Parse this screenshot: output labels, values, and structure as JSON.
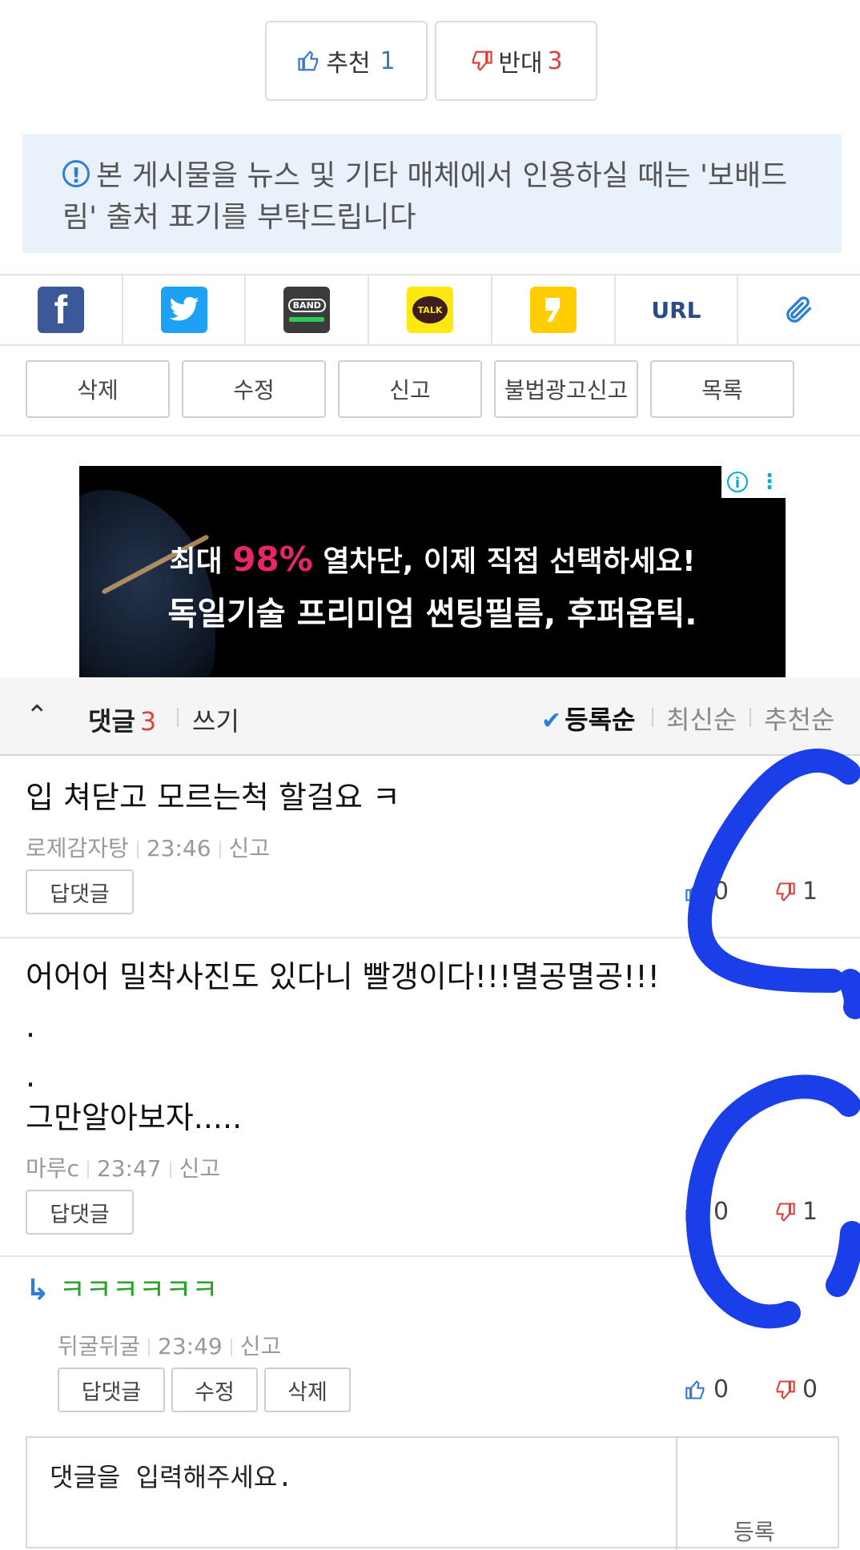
{
  "vote": {
    "up_label": "추천",
    "up_count": "1",
    "down_label": "반대",
    "down_count": "3"
  },
  "notice": {
    "text": "본 게시물을 뉴스 및 기타 매체에서 인용하실 때는 '보배드림' 출처 표기를 부탁드립니다"
  },
  "share": {
    "url_label": "URL",
    "band_label": "BAND",
    "kakao_label": "TALK"
  },
  "actions": [
    "삭제",
    "수정",
    "신고",
    "불법광고신고",
    "목록"
  ],
  "ad": {
    "line1_prefix": "최대",
    "line1_pct": "98%",
    "line1_suffix": "열차단, 이제 직접 선택하세요!",
    "line2": "독일기술 프리미엄 썬팅필름, 후퍼옵틱."
  },
  "comments_header": {
    "title": "댓글",
    "count": "3",
    "write": "쓰기",
    "sort_registered": "등록순",
    "sort_newest": "최신순",
    "sort_recommended": "추천순"
  },
  "comments": [
    {
      "text": "입 쳐닫고 모르는척 할걸요 ㅋ",
      "author": "로제감자탕",
      "time": "23:46",
      "report": "신고",
      "reply_btn": "답댓글",
      "up": "0",
      "down": "1"
    },
    {
      "line1": "어어어 밀착사진도 있다니 빨갱이다!!!멸공멸공!!!",
      "line2": ".",
      "line3": ".",
      "line4": "그만알아보자.....",
      "author": "마루c",
      "time": "23:47",
      "report": "신고",
      "reply_btn": "답댓글",
      "up": "0",
      "down": "1"
    },
    {
      "arrow": "↳",
      "text": "ㅋㅋㅋㅋㅋㅋ",
      "author": "뒤굴뒤굴",
      "time": "23:49",
      "report": "신고",
      "reply_btn": "답댓글",
      "edit_btn": "수정",
      "delete_btn": "삭제",
      "up": "0",
      "down": "0"
    }
  ],
  "input": {
    "placeholder": "댓글을 입력해주세요.",
    "submit": "등록"
  },
  "colors": {
    "accent_blue": "#2d7fd6",
    "down_red": "#e0403d",
    "reply_green": "#2aa12a",
    "scribble_blue": "#1a3fe8"
  }
}
